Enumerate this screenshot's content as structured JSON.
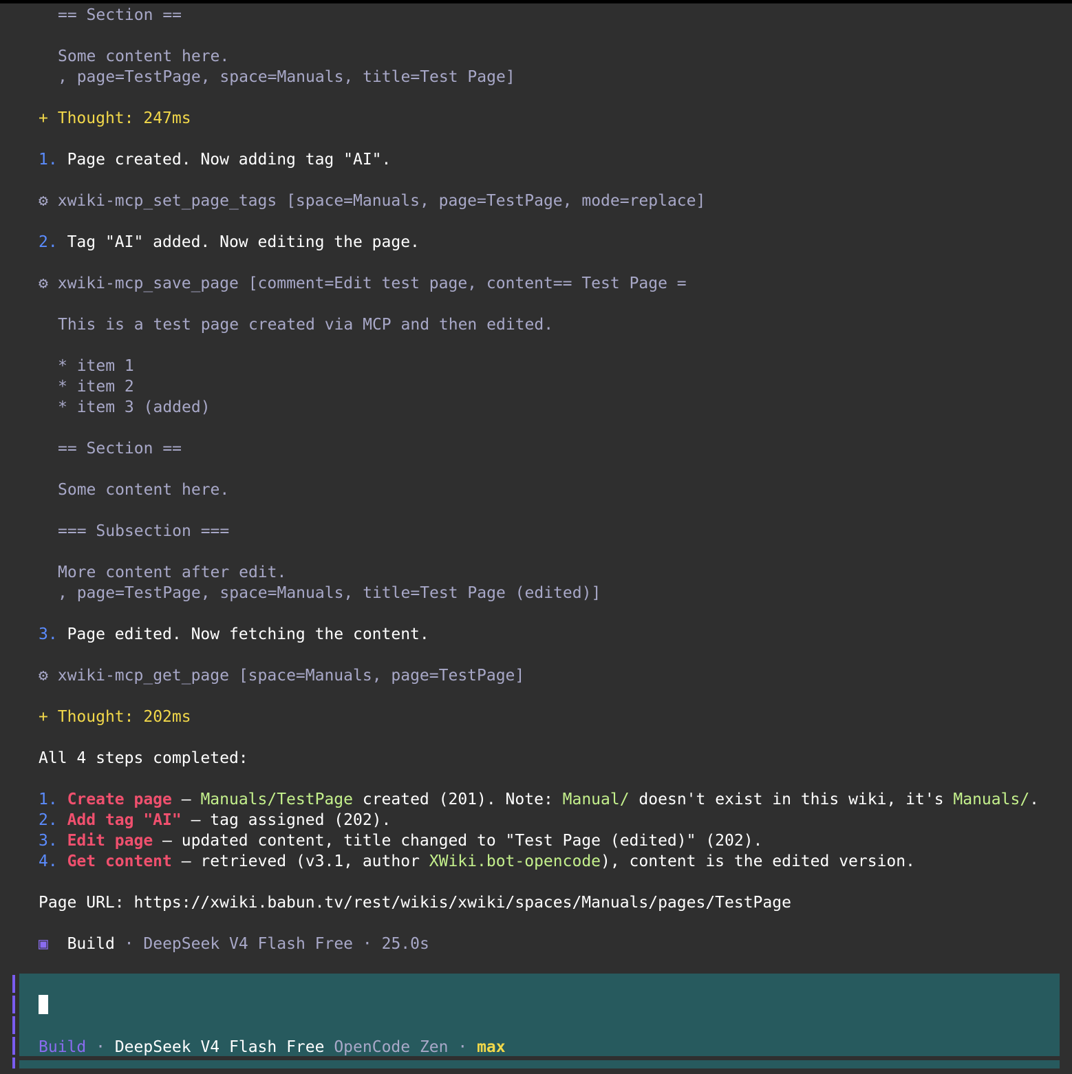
{
  "transcript": {
    "prev_section_heading": "== Section ==",
    "prev_content": "Some content here.",
    "prev_args_tail": ", page=TestPage, space=Manuals, title=Test Page]",
    "thought1": {
      "marker": "+",
      "label": "Thought:",
      "duration": "247ms"
    },
    "step1": {
      "num": "1.",
      "text": "Page created. Now adding tag \"AI\"."
    },
    "tool1": {
      "icon": "⚙",
      "name": "xwiki-mcp_set_page_tags",
      "args": "[space=Manuals, page=TestPage, mode=replace]"
    },
    "step2": {
      "num": "2.",
      "text": "Tag \"AI\" added. Now editing the page."
    },
    "tool2": {
      "icon": "⚙",
      "name": "xwiki-mcp_save_page",
      "args_head": "[comment=Edit test page, content== Test Page =",
      "body": [
        "This is a test page created via MCP and then edited.",
        "* item 1",
        "* item 2",
        "* item 3 (added)",
        "== Section ==",
        "Some content here.",
        "=== Subsection ===",
        "More content after edit.",
        ", page=TestPage, space=Manuals, title=Test Page (edited)]"
      ]
    },
    "step3": {
      "num": "3.",
      "text": "Page edited. Now fetching the content."
    },
    "tool3": {
      "icon": "⚙",
      "name": "xwiki-mcp_get_page",
      "args": "[space=Manuals, page=TestPage]"
    },
    "thought2": {
      "marker": "+",
      "label": "Thought:",
      "duration": "202ms"
    },
    "summary_heading": "All 4 steps completed:",
    "summary": [
      {
        "num": "1.",
        "title": "Create page",
        "parts": [
          " — ",
          "Manuals/TestPage",
          " created (201). Note: ",
          "Manual/",
          " doesn't exist in this wiki, it's ",
          "Manuals/",
          "."
        ]
      },
      {
        "num": "2.",
        "title": "Add tag \"AI\"",
        "rest": " — tag assigned (202)."
      },
      {
        "num": "3.",
        "title": "Edit page",
        "rest": " — updated content, title changed to \"Test Page (edited)\" (202)."
      },
      {
        "num": "4.",
        "title": "Get content",
        "parts": [
          " — retrieved (v3.1, author ",
          "XWiki.bot-opencode",
          "), content is the edited version."
        ]
      }
    ],
    "page_url_label": "Page URL:",
    "page_url": "https://xwiki.babun.tv/rest/wikis/xwiki/spaces/Manuals/pages/TestPage",
    "footer": {
      "icon": "▣",
      "mode": "Build",
      "sep": "·",
      "model": "DeepSeek V4 Flash Free",
      "time": "25.0s"
    }
  },
  "input": {
    "mode": "Build",
    "sep": "·",
    "model": "DeepSeek V4 Flash Free",
    "provider": "OpenCode Zen",
    "variant": "max"
  },
  "colors": {
    "background": "#2f2f2f",
    "input_background": "#275a5e",
    "accent_purple": "#7a5cf0",
    "thought_yellow": "#f2d84a",
    "step_blue": "#5b8cff",
    "title_red": "#f0506e",
    "path_green": "#c4f08c"
  }
}
